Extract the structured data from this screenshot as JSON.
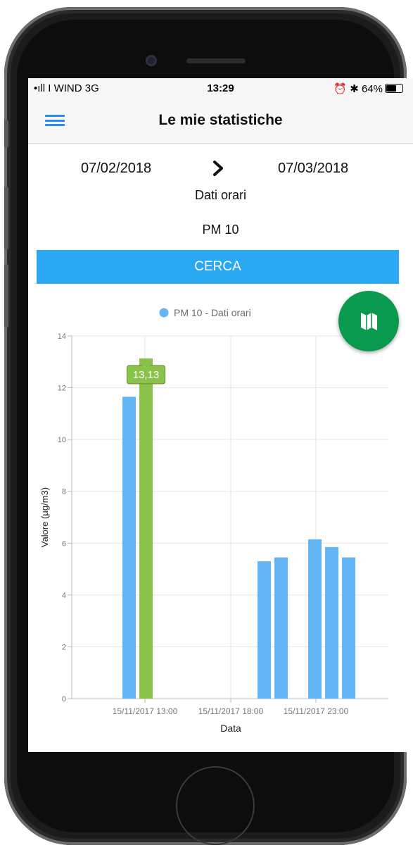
{
  "status_bar": {
    "carrier": "•ıll I WIND  3G",
    "time": "13:29",
    "right": "⏰ ✱ 64%",
    "battery_percent": 64
  },
  "header": {
    "title": "Le mie statistiche",
    "menu_icon": "hamburger-icon"
  },
  "filters": {
    "date_from": "07/02/2018",
    "date_to": "07/03/2018",
    "arrow_icon": "chevron-right-icon",
    "granularity": "Dati orari",
    "pollutant": "PM 10"
  },
  "search_button": {
    "label": "CERCA",
    "color": "#2aa8f2"
  },
  "map_button": {
    "icon": "map-icon",
    "color": "#0a9a4f"
  },
  "chart_data": {
    "type": "bar",
    "legend": [
      "PM 10 - Dati orari"
    ],
    "xlabel": "Data",
    "ylabel": "Valore (µg/m3)",
    "ylim": [
      0,
      14
    ],
    "yticks": [
      0,
      2,
      4,
      6,
      8,
      10,
      12,
      14
    ],
    "xtick_labels": [
      "15/11/2017 13:00",
      "15/11/2017 18:00",
      "15/11/2017 23:00"
    ],
    "grid": true,
    "colors": {
      "bar": "#64b5f6",
      "highlight": "#8bc34a"
    },
    "series": [
      {
        "name": "PM 10 - Dati orari",
        "x": [
          "15/11/2017 12:00",
          "15/11/2017 13:00",
          "15/11/2017 20:00",
          "15/11/2017 21:00",
          "15/11/2017 23:00",
          "16/11/2017 00:00",
          "16/11/2017 01:00"
        ],
        "values": [
          11.65,
          13.13,
          5.3,
          5.45,
          6.15,
          5.85,
          5.45
        ]
      }
    ],
    "highlighted_index": 1,
    "tooltip": "13,13"
  }
}
